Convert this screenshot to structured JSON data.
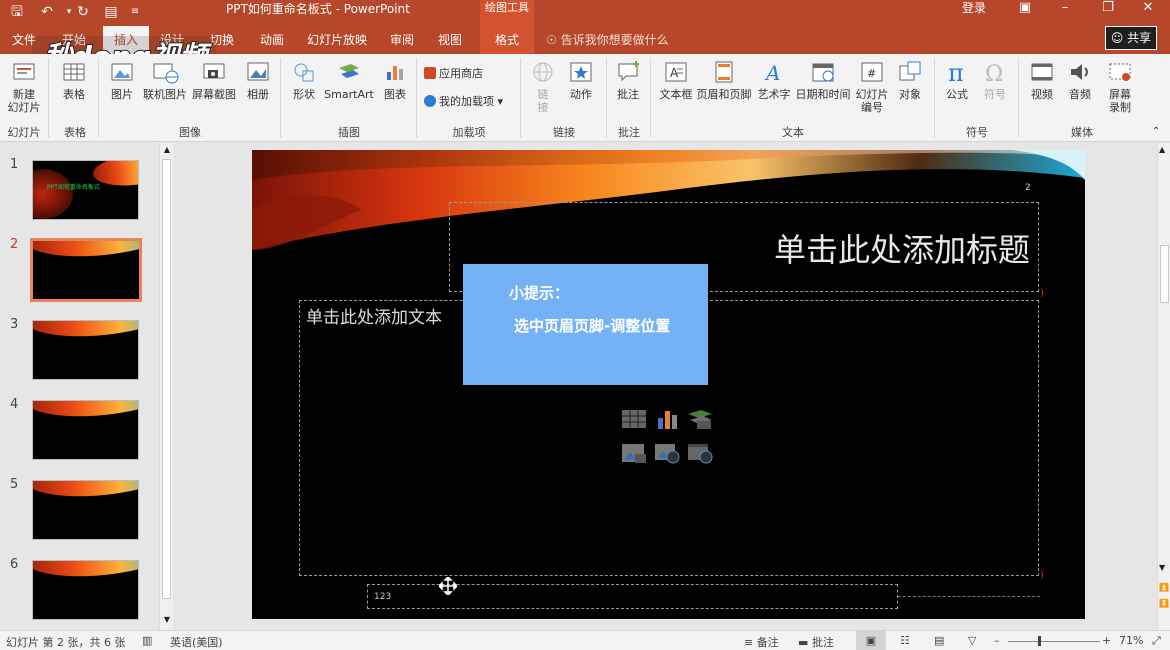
{
  "window": {
    "doc_title": "PPT如何重命名板式 - PowerPoint",
    "context_group": "绘图工具",
    "login": "登录"
  },
  "tabs": [
    {
      "label": "文件"
    },
    {
      "label": "开始"
    },
    {
      "label": "插入",
      "active": true
    },
    {
      "label": "设计"
    },
    {
      "label": "切换"
    },
    {
      "label": "动画"
    },
    {
      "label": "幻灯片放映"
    },
    {
      "label": "审阅"
    },
    {
      "label": "视图"
    },
    {
      "label": "格式",
      "contextual": true
    }
  ],
  "tell_me": "告诉我你想要做什么",
  "share": "共享",
  "logo_text": "秒dong视频",
  "ribbon": {
    "buttons": {
      "new_slide": "新建\n幻灯片",
      "table": "表格",
      "pictures": "图片",
      "online_pictures": "联机图片",
      "screenshot": "屏幕截图",
      "album": "相册",
      "shapes": "形状",
      "smartart": "SmartArt",
      "chart": "图表",
      "store": "应用商店",
      "my_addins": "我的加载项",
      "link": "链\n接",
      "action": "动作",
      "comment": "批注",
      "textbox": "文本框",
      "header_footer": "页眉和页脚",
      "wordart": "艺术字",
      "datetime": "日期和时间",
      "slide_number": "幻灯片\n编号",
      "object": "对象",
      "equation": "公式",
      "symbol": "符号",
      "video": "视频",
      "audio": "音频",
      "screen_recording": "屏幕\n录制"
    },
    "groups": {
      "slides": "幻灯片",
      "tables": "表格",
      "images": "图像",
      "illustrations": "插图",
      "addins": "加载项",
      "links": "链接",
      "comments": "批注",
      "text": "文本",
      "symbols": "符号",
      "media": "媒体"
    }
  },
  "thumbnails": [
    {
      "num": "1",
      "text": "PPT如何重命名板式"
    },
    {
      "num": "2",
      "active": true
    },
    {
      "num": "3"
    },
    {
      "num": "4"
    },
    {
      "num": "5"
    },
    {
      "num": "6"
    }
  ],
  "slide": {
    "title_placeholder": "单击此处添加标题",
    "body_placeholder": "单击此处添加文本",
    "slide_number": "2",
    "footer_text": "123"
  },
  "tip": {
    "title": "小提示：",
    "body": "选中页眉页脚-调整位置"
  },
  "status": {
    "slide_info": "幻灯片 第 2 张，共 6 张",
    "language": "英语(美国)",
    "notes": "备注",
    "comments": "批注",
    "zoom": "71%"
  },
  "colors": {
    "accent": "#b7472a",
    "tip_bg": "#74b1f5"
  }
}
